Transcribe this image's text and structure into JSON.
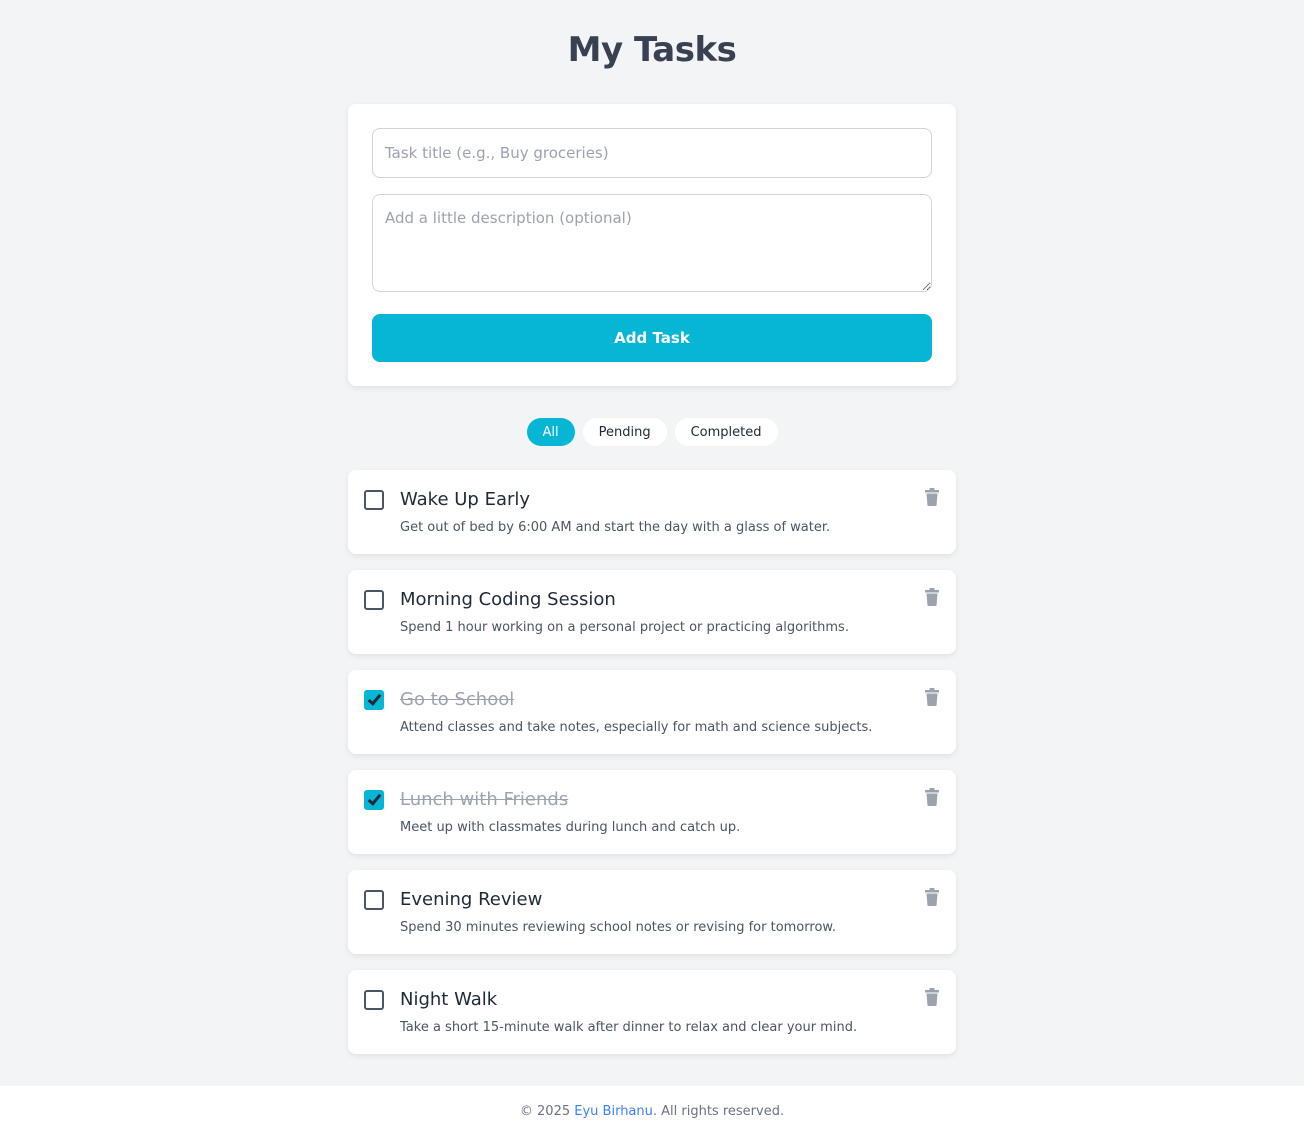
{
  "page": {
    "title": "My Tasks"
  },
  "form": {
    "title_placeholder": "Task title (e.g., Buy groceries)",
    "description_placeholder": "Add a little description (optional)",
    "add_label": "Add Task"
  },
  "filters": {
    "all": "All",
    "pending": "Pending",
    "completed": "Completed",
    "active": "All"
  },
  "tasks": [
    {
      "title": "Wake Up Early",
      "description": "Get out of bed by 6:00 AM and start the day with a glass of water.",
      "completed": false
    },
    {
      "title": "Morning Coding Session",
      "description": "Spend 1 hour working on a personal project or practicing algorithms.",
      "completed": false
    },
    {
      "title": "Go to School",
      "description": "Attend classes and take notes, especially for math and science subjects.",
      "completed": true
    },
    {
      "title": "Lunch with Friends",
      "description": "Meet up with classmates during lunch and catch up.",
      "completed": true
    },
    {
      "title": "Evening Review",
      "description": "Spend 30 minutes reviewing school notes or revising for tomorrow.",
      "completed": false
    },
    {
      "title": "Night Walk",
      "description": "Take a short 15-minute walk after dinner to relax and clear your mind.",
      "completed": false
    }
  ],
  "icons": {
    "delete": "trash-icon",
    "checkbox": "checkmark-icon"
  },
  "colors": {
    "accent": "#06b6d4",
    "background": "#f3f4f6",
    "link": "#3b82f6"
  },
  "footer": {
    "prefix": "© 2025",
    "author": "Eyu Birhanu",
    "suffix": ". All rights reserved."
  }
}
